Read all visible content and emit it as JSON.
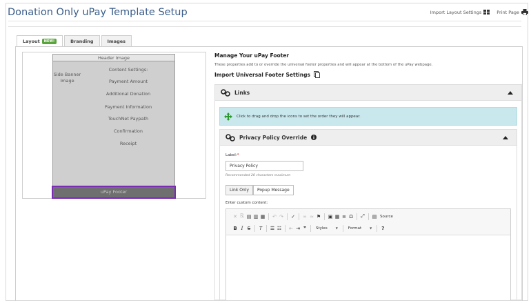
{
  "header": {
    "title": "Donation Only uPay Template Setup",
    "import_layout_label": "Import Layout Settings",
    "print_page_label": "Print Page"
  },
  "tabs": [
    {
      "label": "Layout",
      "badge": "NEW!",
      "active": true
    },
    {
      "label": "Branding",
      "active": false
    },
    {
      "label": "Images",
      "active": false
    }
  ],
  "layout_preview": {
    "header_image": "Header Image",
    "side_banner": "Side Banner Image",
    "content_settings": "Content Settings:",
    "items": [
      "Payment Amount",
      "Additional Donation",
      "Payment Information",
      "TouchNet Paypath",
      "Confirmation",
      "Receipt"
    ],
    "footer": "uPay Footer",
    "selected_color": "#7b2cb5"
  },
  "footer_settings": {
    "heading": "Manage Your uPay Footer",
    "description": "These properties add to or override the universal footer properties and will appear at the bottom of the uPay webpage.",
    "import_label": "Import Universal Footer Settings",
    "links_panel": {
      "title": "Links",
      "info": "Click to drag and drop the icons to set the order they will appear."
    },
    "privacy_panel": {
      "title": "Privacy Policy Override",
      "label_caption": "Label:",
      "required_mark": "*",
      "label_value": "Privacy Policy",
      "hint": "Recommended 20 characters maximum",
      "options": [
        "Link Only",
        "Popup Message"
      ],
      "selected_option": "Popup Message",
      "custom_caption": "Enter custom content:"
    },
    "editor": {
      "source_label": "Source",
      "styles_label": "Styles",
      "format_label": "Format"
    }
  },
  "colors": {
    "title": "#3a5d8a",
    "info_bg": "#c9e8ee",
    "badge": "#5aa43c",
    "move_icon": "#2d9a2d"
  }
}
